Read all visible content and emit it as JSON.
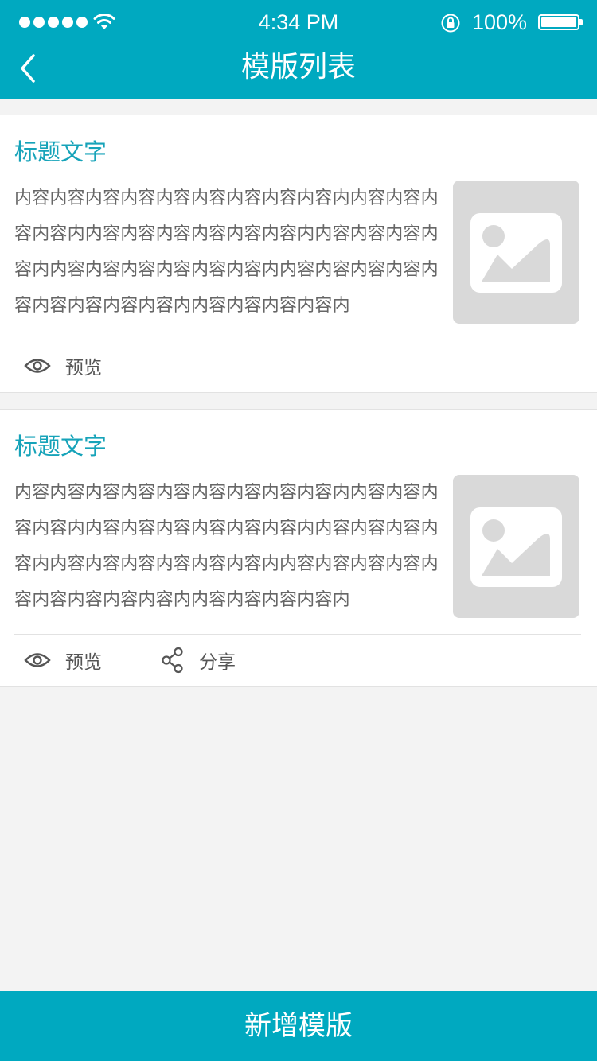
{
  "status_bar": {
    "time": "4:34 PM",
    "battery": "100%"
  },
  "nav": {
    "title": "模版列表"
  },
  "templates": [
    {
      "title": "标题文字",
      "body": "内容内容内容内容内容内容内容内容内容内内容内容内容内容内内容内容内容内容内容内容内内容内容内容内容内内容内容内容内容内容内容内内容内容内容内容内容内容内容内容内容内内容内容内容内容内",
      "actions": {
        "preview": "预览"
      }
    },
    {
      "title": "标题文字",
      "body": "内容内容内容内容内容内容内容内容内容内内容内容内容内容内内容内容内容内容内容内容内内容内容内容内容内内容内容内容内容内容内容内内容内容内容内容内容内容内容内容内容内内容内容内容内容内",
      "actions": {
        "preview": "预览",
        "share": "分享"
      }
    }
  ],
  "footer": {
    "add_template": "新增模版"
  }
}
